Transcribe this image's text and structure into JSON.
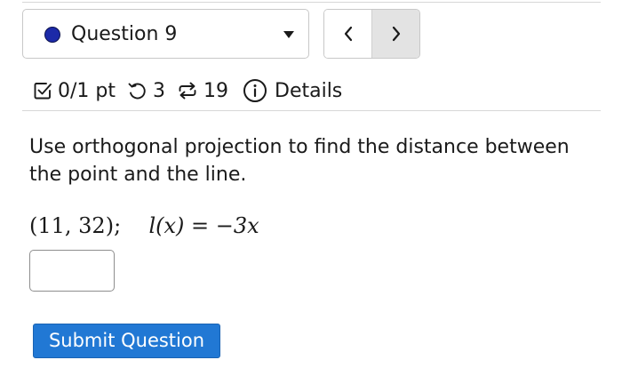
{
  "question_nav": {
    "question_label": "Question 9",
    "dot_color": "#1c2aa8",
    "prev_icon": "chevron-left-icon",
    "next_icon": "chevron-right-icon"
  },
  "meta": {
    "score": "0/1 pt",
    "retries": "3",
    "submissions": "19",
    "details_label": "Details",
    "icons": [
      "checkbox-icon",
      "retry-icon",
      "resubmit-icon",
      "info-icon"
    ]
  },
  "question": {
    "prompt": "Use orthogonal projection to find the distance between the point and the line.",
    "math_point": "(11, 32);",
    "math_function": "l(x) = −3x"
  },
  "answer": {
    "value": ""
  },
  "submit": {
    "label": "Submit Question",
    "color": "#2178d4"
  }
}
